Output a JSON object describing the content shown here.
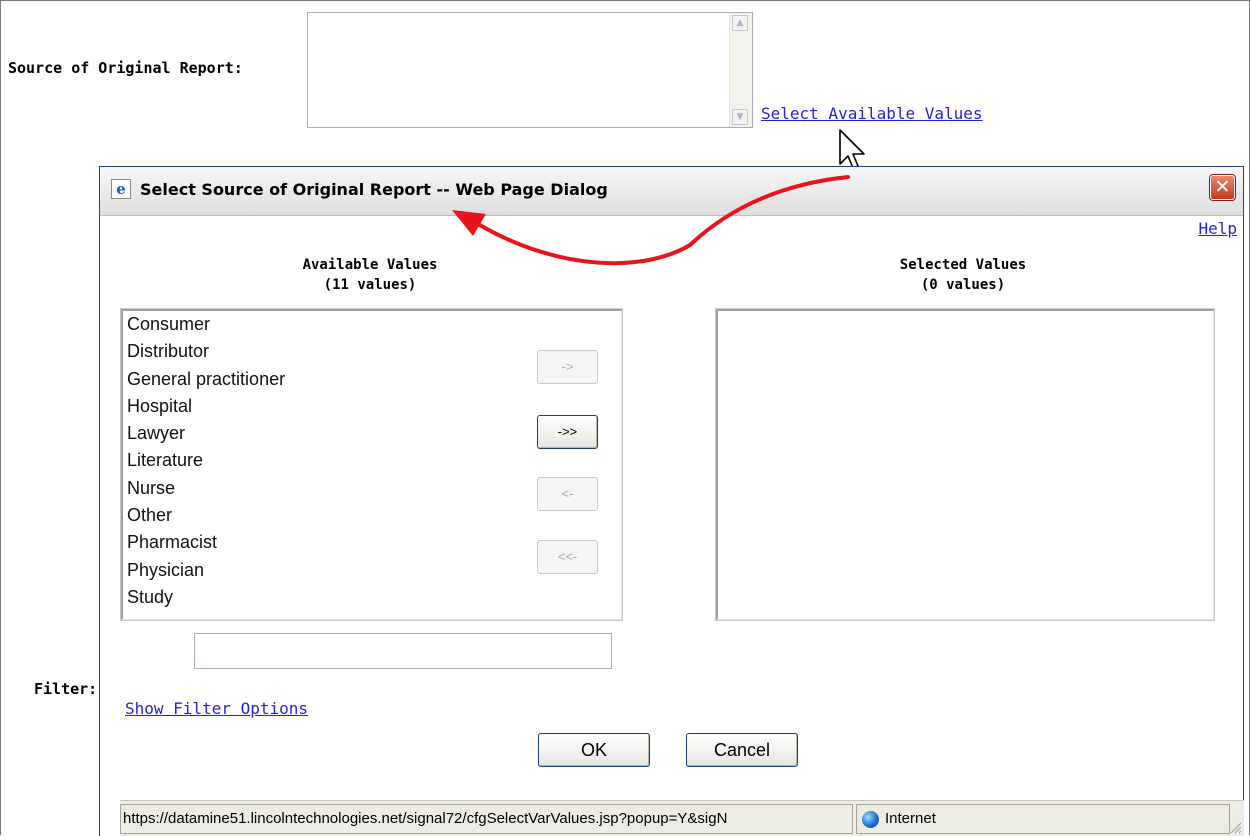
{
  "form": {
    "source_label": "Source of Original Report:",
    "select_link": "Select Available Values",
    "scroll_up_glyph": "▲",
    "scroll_down_glyph": "▼"
  },
  "dialog": {
    "title": "Select Source of Original Report -- Web Page Dialog",
    "title_icon_glyph": "e",
    "close_glyph": "✕",
    "help_link": "Help",
    "available_heading": "Available Values",
    "available_count": "(11 values)",
    "selected_heading": "Selected Values",
    "selected_count": "(0 values)",
    "available_items": [
      "Consumer",
      "Distributor",
      "General practitioner",
      "Hospital",
      "Lawyer",
      "Literature",
      "Nurse",
      "Other",
      "Pharmacist",
      "Physician",
      "Study"
    ],
    "move_buttons": {
      "add": "->",
      "add_all": "->>",
      "remove": "<-",
      "remove_all": "<<-"
    },
    "filter_label": "Filter:",
    "filter_value": "",
    "filter_options_link": "Show Filter Options",
    "ok_label": "OK",
    "cancel_label": "Cancel"
  },
  "statusbar": {
    "url": "https://datamine51.lincolntechnologies.net/signal72/cfgSelectVarValues.jsp?popup=Y&sigN",
    "zone": "Internet"
  },
  "colors": {
    "link": "#2222dd",
    "annotation_arrow": "#e8141b",
    "close_button": "#c7381c"
  }
}
